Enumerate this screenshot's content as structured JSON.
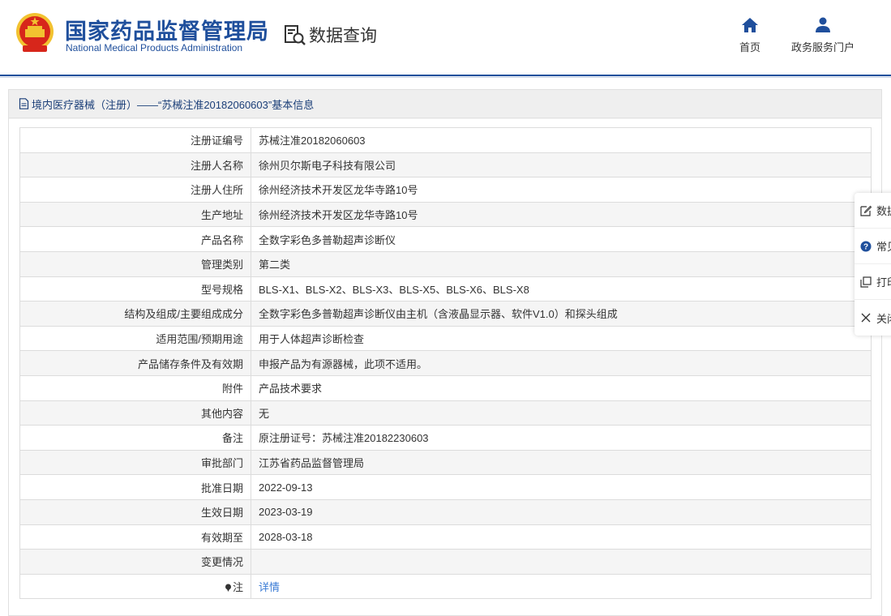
{
  "header": {
    "title_cn": "国家药品监督管理局",
    "title_en": "National Medical Products Administration",
    "query_label": "数据查询",
    "nav": [
      {
        "label": "首页",
        "icon": "home-icon"
      },
      {
        "label": "政务服务门户",
        "icon": "user-icon"
      }
    ]
  },
  "colors": {
    "brand": "#1f4f9c",
    "link": "#3a7bd5",
    "emblem_red": "#d7261b",
    "emblem_gold": "#f2c230"
  },
  "panel": {
    "heading": "境内医疗器械（注册）——“苏械注准20182060603”基本信息"
  },
  "rows": [
    {
      "label": "注册证编号",
      "value": "苏械注准20182060603"
    },
    {
      "label": "注册人名称",
      "value": "徐州贝尔斯电子科技有限公司"
    },
    {
      "label": "注册人住所",
      "value": "徐州经济技术开发区龙华寺路10号"
    },
    {
      "label": "生产地址",
      "value": "徐州经济技术开发区龙华寺路10号"
    },
    {
      "label": "产品名称",
      "value": "全数字彩色多普勒超声诊断仪"
    },
    {
      "label": "管理类别",
      "value": "第二类"
    },
    {
      "label": "型号规格",
      "value": "BLS-X1、BLS-X2、BLS-X3、BLS-X5、BLS-X6、BLS-X8"
    },
    {
      "label": "结构及组成/主要组成成分",
      "value": "全数字彩色多普勒超声诊断仪由主机（含液晶显示器、软件V1.0）和探头组成"
    },
    {
      "label": "适用范围/预期用途",
      "value": "用于人体超声诊断检查"
    },
    {
      "label": "产品储存条件及有效期",
      "value": "申报产品为有源器械，此项不适用。"
    },
    {
      "label": "附件",
      "value": "产品技术要求"
    },
    {
      "label": "其他内容",
      "value": "无"
    },
    {
      "label": "备注",
      "value": "原注册证号：苏械注准20182230603"
    },
    {
      "label": "审批部门",
      "value": "江苏省药品监督管理局"
    },
    {
      "label": "批准日期",
      "value": "2022-09-13"
    },
    {
      "label": "生效日期",
      "value": "2023-03-19"
    },
    {
      "label": "有效期至",
      "value": "2028-03-18"
    },
    {
      "label": "变更情况",
      "value": ""
    }
  ],
  "note_row": {
    "label": "注",
    "link": "详情"
  },
  "sidebar": [
    {
      "label": "数据",
      "icon": "edit-icon"
    },
    {
      "label": "常见",
      "icon": "help-icon"
    },
    {
      "label": "打印",
      "icon": "copy-icon"
    },
    {
      "label": "关闭",
      "icon": "close-icon"
    }
  ]
}
